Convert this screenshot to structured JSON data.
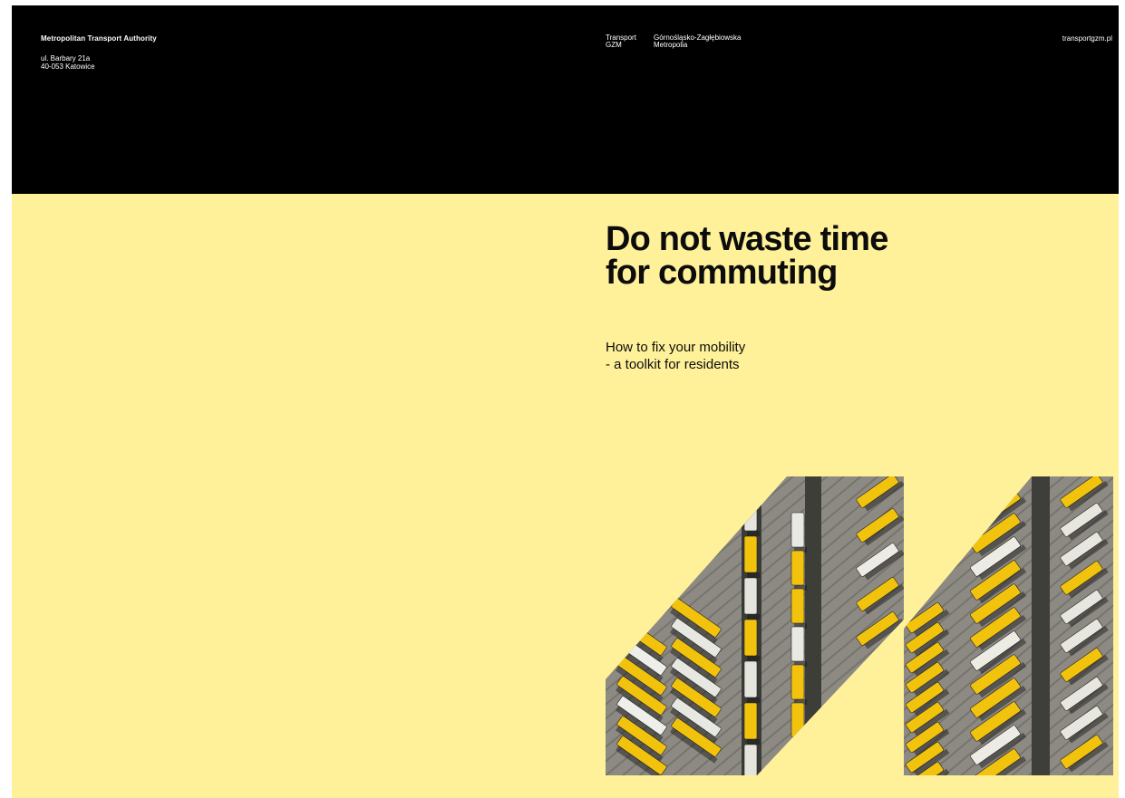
{
  "header": {
    "org_name": "Metropolitan Transport Authority",
    "address_line1": "ul. Barbary 21a",
    "address_line2": "40-053 Katowice",
    "brand_line1": "Transport",
    "brand_line2": "GZM",
    "brand_region_line1": "Górnośląsko-Zagłębiowska",
    "brand_region_line2": "Metropolia",
    "website": "transportgzm.pl"
  },
  "cover": {
    "headline_line1": "Do not waste time",
    "headline_line2": "for commuting",
    "subtitle_line1": "How to fix your mobility",
    "subtitle_line2": "- a toolkit for residents"
  },
  "colors": {
    "header_bg": "#000000",
    "cover_bg": "#fff199",
    "bus_yellow": "#f2c30c",
    "asphalt": "#8d8983"
  }
}
